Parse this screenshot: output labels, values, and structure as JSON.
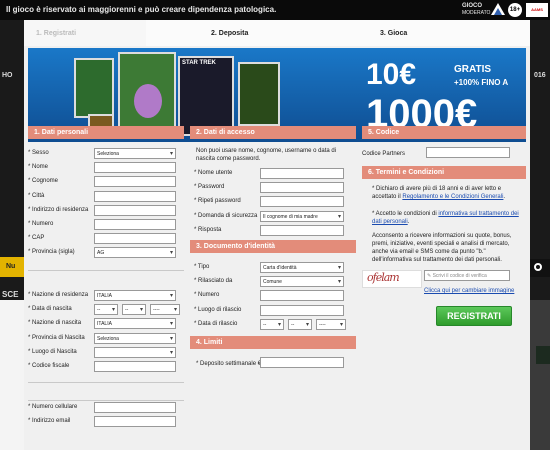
{
  "topbar": {
    "warning": "Il gioco è riservato ai maggiorenni e può creare dipendenza patologica.",
    "gioco_line1": "GIOCO",
    "gioco_line2": "MODERATO",
    "age": "18+",
    "aams": "AAMS"
  },
  "background": {
    "ho": "HO",
    "year": "016",
    "nu": "Nu",
    "sce": "SCE"
  },
  "steps": [
    "1. Registrati",
    "2. Deposita",
    "3. Gioca"
  ],
  "banner": {
    "amount": "10€",
    "gratis": "GRATIS",
    "bonus": "+100% FINO A",
    "max": "1000€",
    "game1": "",
    "game2": "STAR TREK",
    "game3": ""
  },
  "personal": {
    "title": "1. Dati personali",
    "fields": [
      {
        "label": "* Sesso",
        "value": "Seleziona",
        "type": "select"
      },
      {
        "label": "* Nome",
        "value": "",
        "type": "text"
      },
      {
        "label": "* Cognome",
        "value": "",
        "type": "text"
      },
      {
        "label": "* Città",
        "value": "",
        "type": "text"
      },
      {
        "label": "* Indirizzo di residenza",
        "value": "",
        "type": "text"
      },
      {
        "label": "* Numero",
        "value": "",
        "type": "text"
      },
      {
        "label": "* CAP",
        "value": "",
        "type": "text"
      },
      {
        "label": "* Provincia (sigla)",
        "value": "AG",
        "type": "select"
      }
    ],
    "fields2": [
      {
        "label": "* Nazione di residenza",
        "value": "ITALIA",
        "type": "select"
      },
      {
        "label": "* Data di nascita",
        "value": "",
        "type": "date"
      },
      {
        "label": "* Nazione di nascita",
        "value": "ITALIA",
        "type": "select"
      },
      {
        "label": "* Provincia di Nascita",
        "value": "Seleziona",
        "type": "select"
      },
      {
        "label": "* Luogo di Nascita",
        "value": "",
        "type": "select"
      },
      {
        "label": "* Codice fiscale",
        "value": "",
        "type": "text"
      }
    ],
    "fields3": [
      {
        "label": "* Numero cellulare",
        "value": "",
        "type": "text"
      },
      {
        "label": "* Indirizzo email",
        "value": "",
        "type": "text"
      }
    ],
    "date_parts": [
      "--",
      "--",
      "----"
    ]
  },
  "access": {
    "title": "2. Dati di accesso",
    "note": "Non puoi usare nome, cognome, username o data di nascita come password.",
    "fields": [
      {
        "label": "* Nome utente",
        "value": "",
        "type": "text"
      },
      {
        "label": "* Password",
        "value": "",
        "type": "text"
      },
      {
        "label": "* Ripeti password",
        "value": "",
        "type": "text"
      },
      {
        "label": "* Domanda di sicurezza",
        "value": "Il cognome di mia madre",
        "type": "select"
      },
      {
        "label": "* Risposta",
        "value": "",
        "type": "text"
      }
    ]
  },
  "identity": {
    "title": "3. Documento d'identità",
    "fields": [
      {
        "label": "* Tipo",
        "value": "Carta d'identità",
        "type": "select"
      },
      {
        "label": "* Rilasciato da",
        "value": "Comune",
        "type": "select"
      },
      {
        "label": "* Numero",
        "value": "",
        "type": "text"
      },
      {
        "label": "* Luogo di rilascio",
        "value": "",
        "type": "text"
      },
      {
        "label": "* Data di rilascio",
        "value": "",
        "type": "date"
      }
    ]
  },
  "limits": {
    "title": "4. Limiti",
    "label": "* Deposito settimanale €",
    "value": ""
  },
  "code": {
    "title": "5. Codice",
    "label": "Codice Partners",
    "value": ""
  },
  "terms": {
    "title": "6. Termini e Condizioni",
    "t1_pre": "* Dichiaro di avere più di 18 anni e di aver letto e accettato il ",
    "t1_link": "Regolamento e le Condizioni Generali",
    "t1_post": ".",
    "t2_pre": "* Accetto le condizioni di ",
    "t2_link": "informativa sul trattamento dei dati personali",
    "t2_post": ".",
    "t3": "Acconsento a ricevere informazioni su quote, bonus, premi, iniziative, eventi speciali e analisi di mercato, anche via email e SMS come da punto \"b.\" dell'informativa sul trattamento dei dati personali.",
    "captcha_text": "ofelam",
    "captcha_placeholder": "Scrivi il codice di verifica",
    "refresh_link": "Clicca qui per cambiare immagine",
    "submit": "REGISTRATI"
  }
}
